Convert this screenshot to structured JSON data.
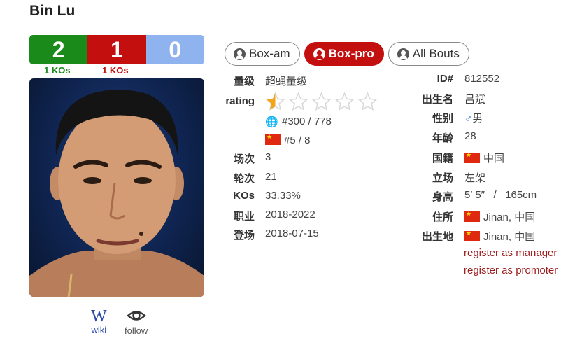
{
  "boxer": {
    "name": "Bin Lu"
  },
  "record": {
    "wins": "2",
    "losses": "1",
    "draws": "0",
    "wins_kos": "1 KOs",
    "losses_kos": "1 KOs",
    "colors": {
      "win": "#1a8a1a",
      "loss": "#c40f0f",
      "draw": "#8fb3ef"
    }
  },
  "links": {
    "wiki": "wiki",
    "follow": "follow"
  },
  "tabs": [
    {
      "label": "Box-am",
      "active": false
    },
    {
      "label": "Box-pro",
      "active": true
    },
    {
      "label": "All Bouts",
      "active": false
    }
  ],
  "left_table": {
    "division_label": "量级",
    "division": "超蝇量级",
    "rating_label": "rating",
    "rating_stars": 0.5,
    "rating_max": 5,
    "world_rank": "#300 / 778",
    "country_rank": "#5 / 8",
    "bouts_label": "场次",
    "bouts": "3",
    "rounds_label": "轮次",
    "rounds": "21",
    "kos_label": "KOs",
    "kos": "33.33%",
    "career_label": "职业",
    "career": "2018-2022",
    "debut_label": "登场",
    "debut": "2018-07-15"
  },
  "right_table": {
    "id_label": "ID#",
    "id": "812552",
    "birthname_label": "出生名",
    "birthname": "吕斌",
    "sex_label": "性别",
    "sex": "男",
    "age_label": "年龄",
    "age": "28",
    "nationality_label": "国籍",
    "nationality": "中国",
    "stance_label": "立场",
    "stance": "左架",
    "height_label": "身高",
    "height": "5′ 5″   /   165cm",
    "residence_label": "住所",
    "residence": "Jinan, 中国",
    "birthplace_label": "出生地",
    "birthplace": "Jinan, 中国"
  },
  "actions": {
    "register_manager": "register as manager",
    "register_promoter": "register as promoter"
  },
  "icons": {
    "user": "user-circle-icon",
    "globe": "globe-icon",
    "flag": "china-flag-icon",
    "sex": "male-symbol-icon",
    "eye": "eye-icon",
    "star": "star-icon"
  },
  "accent": "#c40f0f"
}
